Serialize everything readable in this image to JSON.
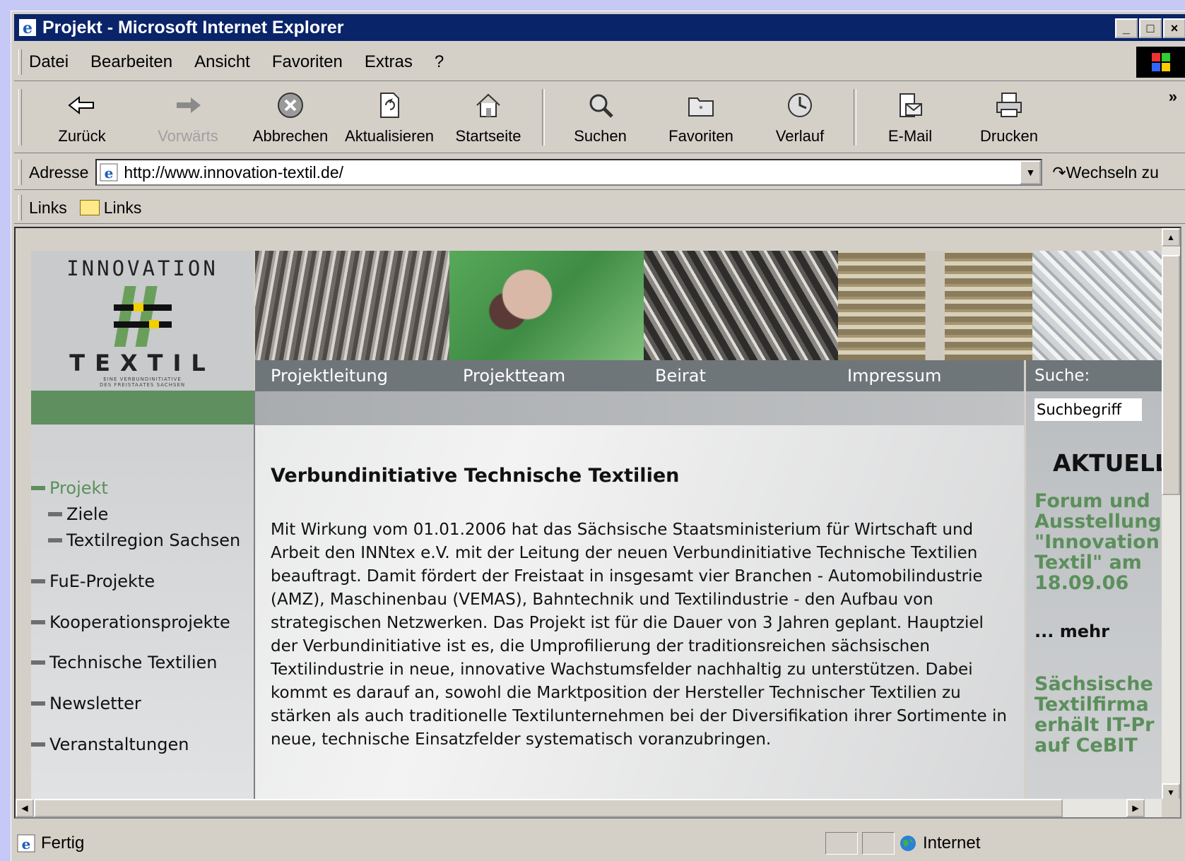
{
  "window": {
    "title": "Projekt - Microsoft Internet Explorer",
    "minimize": "_",
    "maximize": "□",
    "close": "×"
  },
  "menu": {
    "items": [
      {
        "label": "Datei"
      },
      {
        "label": "Bearbeiten"
      },
      {
        "label": "Ansicht"
      },
      {
        "label": "Favoriten"
      },
      {
        "label": "Extras"
      },
      {
        "label": "?"
      }
    ]
  },
  "toolbar": {
    "back": "Zurück",
    "forward": "Vorwärts",
    "stop": "Abbrechen",
    "refresh": "Aktualisieren",
    "home": "Startseite",
    "search": "Suchen",
    "favorites": "Favoriten",
    "history": "Verlauf",
    "mail": "E-Mail",
    "print": "Drucken",
    "more": "»"
  },
  "address": {
    "label": "Adresse",
    "url": "http://www.innovation-textil.de/",
    "go": "Wechseln zu"
  },
  "links": {
    "label": "Links",
    "folder": "Links"
  },
  "page": {
    "logo": {
      "top": "INNOVATION",
      "bottom": "TEXTIL",
      "tagline_1": "EINE VERBUNDINITIATIVE",
      "tagline_2": "DES FREISTAATES SACHSEN"
    },
    "topnav": [
      "Projektleitung",
      "Projektteam",
      "Beirat",
      "Impressum"
    ],
    "search": {
      "label": "Suche:",
      "placeholder": "Suchbegriff"
    },
    "sidenav": [
      {
        "label": "Projekt",
        "active": true
      },
      {
        "label": "Ziele"
      },
      {
        "label": "Textilregion Sachsen"
      },
      {
        "label": "FuE-Projekte"
      },
      {
        "label": "Kooperationsprojekte"
      },
      {
        "label": "Technische Textilien"
      },
      {
        "label": "Newsletter"
      },
      {
        "label": "Veranstaltungen"
      }
    ],
    "heading": "Verbundinitiative Technische Textilien",
    "body": "Mit Wirkung vom 01.01.2006 hat das Sächsische Staatsministerium für Wirtschaft und Arbeit den INNtex e.V. mit der Leitung der neuen Verbundinitiative Technische Textilien beauftragt. Damit fördert der Freistaat in insgesamt vier Branchen - Automobilindustrie (AMZ), Maschinenbau (VEMAS), Bahntechnik und Textilindustrie - den Aufbau von strategischen Netzwerken. Das Projekt ist für die Dauer von 3 Jahren geplant. Hauptziel der Verbundinitiative ist es, die Umprofilierung der traditionsreichen sächsischen Textilindustrie in neue, innovative Wachstumsfelder nachhaltig zu unterstützen. Dabei kommt es darauf an, sowohl die Marktposition der Hersteller Technischer Textilien zu stärken als auch traditionelle Textilunternehmen bei der Diversifikation ihrer Sortimente in neue, technische Einsatzfelder systematisch voranzubringen.",
    "aktuell": {
      "title": "AKTUELL",
      "news_1": "Forum und\nAusstellung\n\"Innovation\nTextil\" am\n18.09.06",
      "more": "... mehr",
      "news_2": "Sächsische\nTextilfirma\nerhält IT-Pr\nauf CeBIT"
    },
    "colors": {
      "green": "#5b8f5b",
      "nav_gray": "#6f767a"
    }
  },
  "status": {
    "text": "Fertig",
    "zone": "Internet"
  }
}
